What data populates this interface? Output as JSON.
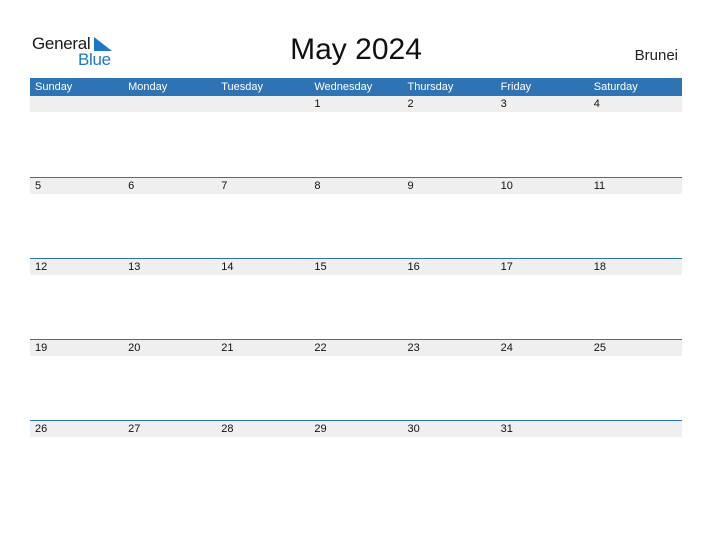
{
  "logo": {
    "part1": "General",
    "part2": "Blue",
    "icon": "triangle-flag-icon"
  },
  "title": "May 2024",
  "country": "Brunei",
  "colors": {
    "header": "#2e74b5",
    "date_strip": "#efefef",
    "logo_blue": "#1f77c8"
  },
  "weekdays": [
    "Sunday",
    "Monday",
    "Tuesday",
    "Wednesday",
    "Thursday",
    "Friday",
    "Saturday"
  ],
  "weeks": [
    [
      "",
      "",
      "",
      "1",
      "2",
      "3",
      "4"
    ],
    [
      "5",
      "6",
      "7",
      "8",
      "9",
      "10",
      "11"
    ],
    [
      "12",
      "13",
      "14",
      "15",
      "16",
      "17",
      "18"
    ],
    [
      "19",
      "20",
      "21",
      "22",
      "23",
      "24",
      "25"
    ],
    [
      "26",
      "27",
      "28",
      "29",
      "30",
      "31",
      ""
    ]
  ]
}
